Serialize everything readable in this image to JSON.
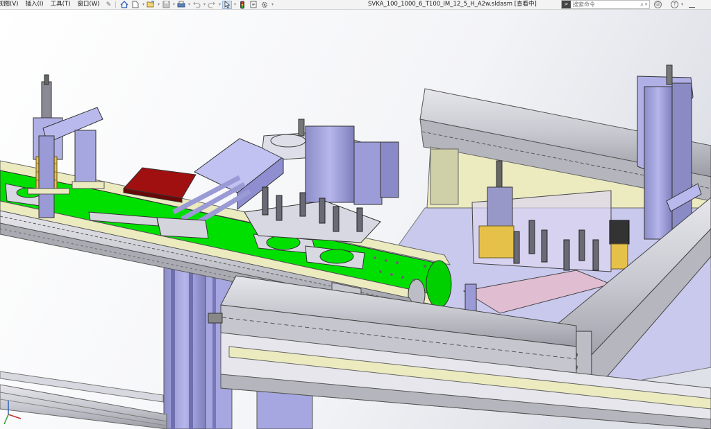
{
  "menu": {
    "items": [
      {
        "label": "视图(V)"
      },
      {
        "label": "插入(I)"
      },
      {
        "label": "工具(T)"
      },
      {
        "label": "窗口(W)"
      }
    ]
  },
  "document": {
    "title": "SVKA_100_1000_6_T100_IM_12_5_H_A2w.sldasm [查看中]"
  },
  "search": {
    "placeholder": "搜索命令"
  },
  "toolbar": {
    "icons": [
      "pin-icon",
      "home-icon",
      "new-icon",
      "open-icon",
      "save-icon",
      "print-icon",
      "undo-icon",
      "redo-icon",
      "select-icon",
      "rebuild-icon",
      "file-properties-icon",
      "options-icon"
    ]
  },
  "hud": {
    "icons": [
      "zoom-to-fit-icon",
      "zoom-area-icon",
      "previous-view-icon",
      "section-view-icon",
      "view-orientation-icon",
      "display-style-icon",
      "hide-show-icon",
      "edit-appearance-icon",
      "apply-scene-icon",
      "view-settings-icon"
    ]
  },
  "colors": {
    "accent": "#2a62b8",
    "belt_green": "#00e000",
    "frame_gray": "#c8c8d0",
    "blue_metal": "#a8a8e0",
    "red_bin": "#a01010",
    "cream_plate": "#ecebc0"
  }
}
